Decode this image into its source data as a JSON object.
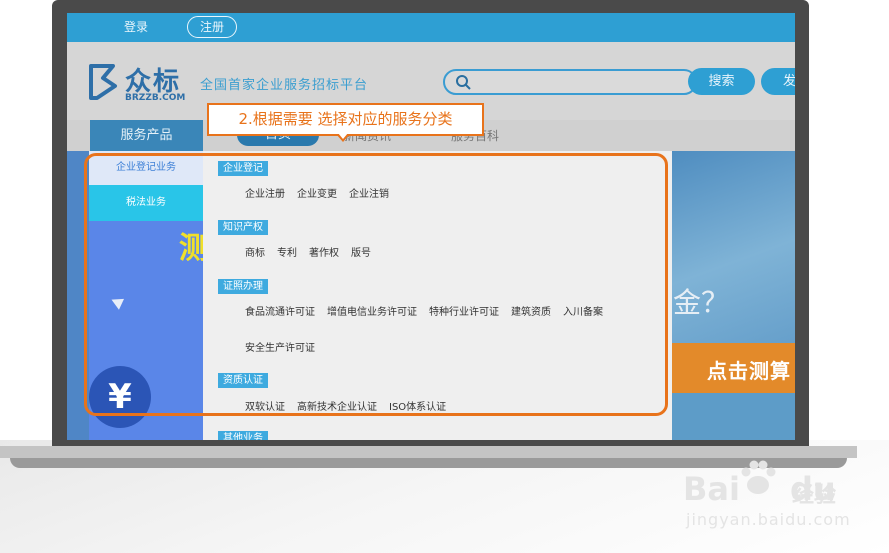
{
  "topbar": {
    "login_label": "登录",
    "register_label": "注册"
  },
  "header": {
    "logo_text": "众标",
    "logo_sub": "BRZZB.COM",
    "slogan": "全国首家企业服务招标平台",
    "search_placeholder": "",
    "search_button": "搜索",
    "publish_button": "发"
  },
  "nav": {
    "products_label": "服务产品",
    "home_label": "首页",
    "news_label": "新闻资讯",
    "encyclopedia_label": "服务百科"
  },
  "side_menu": {
    "items": [
      {
        "label": "企业登记业务"
      },
      {
        "label": "税法业务"
      }
    ]
  },
  "banner": {
    "side_char": "测",
    "gold_text": "金？",
    "cta_text": "点击测算",
    "coin_symbol": "¥"
  },
  "categories": [
    {
      "title": "企业登记",
      "links": [
        "企业注册",
        "企业变更",
        "企业注销"
      ]
    },
    {
      "title": "知识产权",
      "links": [
        "商标",
        "专利",
        "著作权",
        "版号"
      ]
    },
    {
      "title": "证照办理",
      "links": [
        "食品流通许可证",
        "增值电信业务许可证",
        "特种行业许可证",
        "建筑资质",
        "入川备案"
      ],
      "links_row2": [
        "安全生产许可证"
      ]
    },
    {
      "title": "资质认证",
      "links": [
        "双软认证",
        "高新技术企业认证",
        "ISO体系认证"
      ]
    },
    {
      "title": "其他业务"
    }
  ],
  "annotation": {
    "callout_text": "2.根据需要 选择对应的服务分类",
    "color": "#e8731b"
  },
  "watermark": {
    "logo": "Bai",
    "logo_suffix": "du",
    "text": "经验",
    "url": "jingyan.baidu.com"
  },
  "colors": {
    "primary": "#2e9fd3",
    "accent": "#e8731b",
    "side_active": "#29c5e8"
  }
}
